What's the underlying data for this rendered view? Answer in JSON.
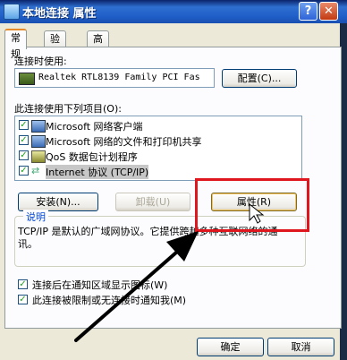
{
  "window": {
    "title": "本地连接 属性",
    "help_label": "?",
    "close_label": "✕"
  },
  "tabs": [
    {
      "label": "常规",
      "active": true
    },
    {
      "label": "验证",
      "active": false
    },
    {
      "label": "高级",
      "active": false
    }
  ],
  "connect_using": {
    "label": "连接时使用:",
    "adapter": "Realtek RTL8139 Family PCI Fas",
    "configure_label": "配置(C)..."
  },
  "items_section": {
    "label": "此连接使用下列项目(O):",
    "items": [
      {
        "label": "Microsoft 网络客户端",
        "checked": true,
        "icon": "network-client-icon"
      },
      {
        "label": "Microsoft 网络的文件和打印机共享",
        "checked": true,
        "icon": "file-share-icon"
      },
      {
        "label": "QoS 数据包计划程序",
        "checked": true,
        "icon": "qos-icon"
      },
      {
        "label": "Internet 协议 (TCP/IP)",
        "checked": true,
        "icon": "protocol-icon",
        "selected": true
      }
    ]
  },
  "item_buttons": {
    "install_label": "安装(N)...",
    "uninstall_label": "卸载(U)",
    "properties_label": "属性(R)"
  },
  "description": {
    "title": "说明",
    "text": "TCP/IP 是默认的广域网协议。它提供跨越多种互联网络的通讯。"
  },
  "options": {
    "show_icon_label": "连接后在通知区域显示图标(W)",
    "notify_label": "此连接被限制或无连接时通知我(M)",
    "show_icon_checked": true,
    "notify_checked": true
  },
  "footer": {
    "ok_label": "确定",
    "cancel_label": "取消"
  },
  "colors": {
    "highlight_box": "#e0161f",
    "title_bar": "#1f5fc8"
  }
}
